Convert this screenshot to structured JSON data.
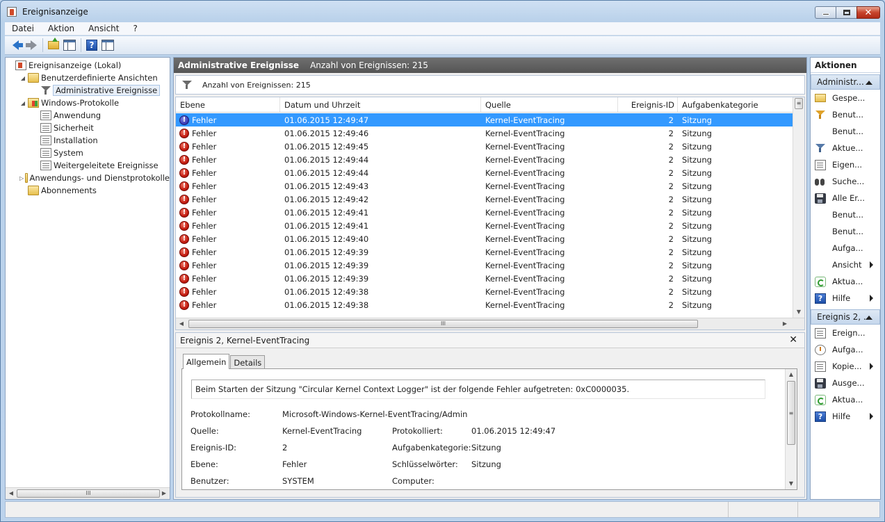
{
  "window": {
    "title": "Ereignisanzeige"
  },
  "menu": [
    "Datei",
    "Aktion",
    "Ansicht",
    "?"
  ],
  "tree": [
    {
      "label": "Ereignisanzeige (Lokal)",
      "icon": "viewer-icon",
      "indent": 0,
      "expander": ""
    },
    {
      "label": "Benutzerdefinierte Ansichten",
      "icon": "folder-icon",
      "indent": 1,
      "expander": "◢"
    },
    {
      "label": "Administrative Ereignisse",
      "icon": "filter-icon",
      "indent": 2,
      "expander": "",
      "selected": true
    },
    {
      "label": "Windows-Protokolle",
      "icon": "windows-logs-icon",
      "indent": 1,
      "expander": "◢"
    },
    {
      "label": "Anwendung",
      "icon": "log-icon",
      "indent": 2,
      "expander": ""
    },
    {
      "label": "Sicherheit",
      "icon": "log-icon",
      "indent": 2,
      "expander": ""
    },
    {
      "label": "Installation",
      "icon": "log-icon",
      "indent": 2,
      "expander": ""
    },
    {
      "label": "System",
      "icon": "log-icon",
      "indent": 2,
      "expander": ""
    },
    {
      "label": "Weitergeleitete Ereignisse",
      "icon": "log-icon",
      "indent": 2,
      "expander": ""
    },
    {
      "label": "Anwendungs- und Dienstprotokolle",
      "icon": "folder-icon",
      "indent": 1,
      "expander": "▷"
    },
    {
      "label": "Abonnements",
      "icon": "folder-icon",
      "indent": 1,
      "expander": ""
    }
  ],
  "center": {
    "header_title": "Administrative Ereignisse",
    "header_count": "Anzahl von Ereignissen: 215",
    "filter_text": "Anzahl von Ereignissen: 215",
    "columns": [
      "Ebene",
      "Datum und Uhrzeit",
      "Quelle",
      "Ereignis-ID",
      "Aufgabenkategorie"
    ],
    "rows": [
      {
        "level": "Fehler",
        "date": "01.06.2015 12:49:47",
        "source": "Kernel-EventTracing",
        "id": "2",
        "category": "Sitzung",
        "selected": true
      },
      {
        "level": "Fehler",
        "date": "01.06.2015 12:49:46",
        "source": "Kernel-EventTracing",
        "id": "2",
        "category": "Sitzung"
      },
      {
        "level": "Fehler",
        "date": "01.06.2015 12:49:45",
        "source": "Kernel-EventTracing",
        "id": "2",
        "category": "Sitzung"
      },
      {
        "level": "Fehler",
        "date": "01.06.2015 12:49:44",
        "source": "Kernel-EventTracing",
        "id": "2",
        "category": "Sitzung"
      },
      {
        "level": "Fehler",
        "date": "01.06.2015 12:49:44",
        "source": "Kernel-EventTracing",
        "id": "2",
        "category": "Sitzung"
      },
      {
        "level": "Fehler",
        "date": "01.06.2015 12:49:43",
        "source": "Kernel-EventTracing",
        "id": "2",
        "category": "Sitzung"
      },
      {
        "level": "Fehler",
        "date": "01.06.2015 12:49:42",
        "source": "Kernel-EventTracing",
        "id": "2",
        "category": "Sitzung"
      },
      {
        "level": "Fehler",
        "date": "01.06.2015 12:49:41",
        "source": "Kernel-EventTracing",
        "id": "2",
        "category": "Sitzung"
      },
      {
        "level": "Fehler",
        "date": "01.06.2015 12:49:41",
        "source": "Kernel-EventTracing",
        "id": "2",
        "category": "Sitzung"
      },
      {
        "level": "Fehler",
        "date": "01.06.2015 12:49:40",
        "source": "Kernel-EventTracing",
        "id": "2",
        "category": "Sitzung"
      },
      {
        "level": "Fehler",
        "date": "01.06.2015 12:49:39",
        "source": "Kernel-EventTracing",
        "id": "2",
        "category": "Sitzung"
      },
      {
        "level": "Fehler",
        "date": "01.06.2015 12:49:39",
        "source": "Kernel-EventTracing",
        "id": "2",
        "category": "Sitzung"
      },
      {
        "level": "Fehler",
        "date": "01.06.2015 12:49:39",
        "source": "Kernel-EventTracing",
        "id": "2",
        "category": "Sitzung"
      },
      {
        "level": "Fehler",
        "date": "01.06.2015 12:49:38",
        "source": "Kernel-EventTracing",
        "id": "2",
        "category": "Sitzung"
      },
      {
        "level": "Fehler",
        "date": "01.06.2015 12:49:38",
        "source": "Kernel-EventTracing",
        "id": "2",
        "category": "Sitzung"
      }
    ],
    "hscroll_grip": "III"
  },
  "detail": {
    "title": "Ereignis 2, Kernel-EventTracing",
    "tabs": [
      "Allgemein",
      "Details"
    ],
    "message": "Beim Starten der Sitzung \"Circular Kernel Context Logger\" ist der folgende Fehler aufgetreten: 0xC0000035.",
    "fields": {
      "protokollname_label": "Protokollname:",
      "protokollname_value": "Microsoft-Windows-Kernel-EventTracing/Admin",
      "quelle_label": "Quelle:",
      "quelle_value": "Kernel-EventTracing",
      "protokolliert_label": "Protokolliert:",
      "protokolliert_value": "01.06.2015 12:49:47",
      "ereignisid_label": "Ereignis-ID:",
      "ereignisid_value": "2",
      "aufgabe_label": "Aufgabenkategorie:",
      "aufgabe_value": "Sitzung",
      "ebene_label": "Ebene:",
      "ebene_value": "Fehler",
      "schluessel_label": "Schlüsselwörter:",
      "schluessel_value": "Sitzung",
      "benutzer_label": "Benutzer:",
      "benutzer_value": "SYSTEM",
      "computer_label": "Computer:"
    }
  },
  "actions": {
    "title": "Aktionen",
    "section1": "Administr...",
    "items1": [
      {
        "label": "Gespe...",
        "icon": "open-folder-icon",
        "submenu": false
      },
      {
        "label": "Benut...",
        "icon": "create-view-filter-icon",
        "submenu": false
      },
      {
        "label": "Benut...",
        "icon": "",
        "submenu": false
      },
      {
        "label": "Aktue...",
        "icon": "filter-current-icon",
        "submenu": false
      },
      {
        "label": "Eigen...",
        "icon": "properties-icon",
        "submenu": false
      },
      {
        "label": "Suche...",
        "icon": "find-binoculars-icon",
        "submenu": false
      },
      {
        "label": "Alle Er...",
        "icon": "save-icon",
        "submenu": false
      },
      {
        "label": "Benut...",
        "icon": "",
        "submenu": false
      },
      {
        "label": "Benut...",
        "icon": "",
        "submenu": false
      },
      {
        "label": "Aufga...",
        "icon": "",
        "submenu": false
      },
      {
        "label": "Ansicht",
        "icon": "",
        "submenu": true
      },
      {
        "label": "Aktua...",
        "icon": "refresh-icon",
        "submenu": false
      },
      {
        "label": "Hilfe",
        "icon": "help-icon",
        "submenu": true
      }
    ],
    "section2": "Ereignis 2, ...",
    "items2": [
      {
        "label": "Ereign...",
        "icon": "event-properties-icon",
        "submenu": false
      },
      {
        "label": "Aufga...",
        "icon": "attach-task-icon",
        "submenu": false
      },
      {
        "label": "Kopie...",
        "icon": "copy-icon",
        "submenu": true
      },
      {
        "label": "Ausge...",
        "icon": "save-icon",
        "submenu": false
      },
      {
        "label": "Aktua...",
        "icon": "refresh-icon",
        "submenu": false
      },
      {
        "label": "Hilfe",
        "icon": "help-icon",
        "submenu": true
      }
    ]
  },
  "left_hscroll_grip": "III"
}
